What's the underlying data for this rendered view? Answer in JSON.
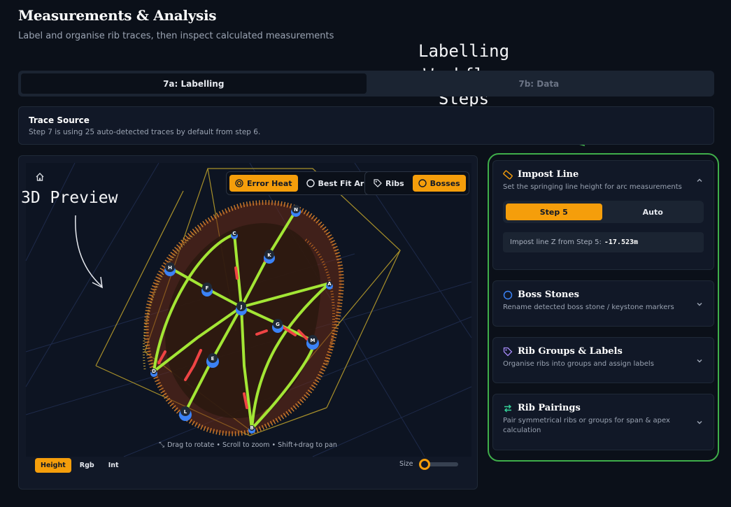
{
  "header": {
    "title": "Measurements & Analysis",
    "subtitle": "Label and organise rib traces, then inspect calculated measurements"
  },
  "annotations": {
    "workflow": "Labelling Workflow Steps",
    "preview": "3D Preview"
  },
  "tabs": [
    {
      "label": "7a: Labelling",
      "active": true
    },
    {
      "label": "7b: Data",
      "active": false
    }
  ],
  "trace_source": {
    "title": "Trace Source",
    "description": "Step 7 is using 25 auto-detected traces by default from step 6."
  },
  "preview": {
    "overlay_toggles": [
      {
        "label": "Error Heat",
        "on": true,
        "icon": "target-icon"
      },
      {
        "label": "Best Fit Arc",
        "on": false,
        "icon": "circle-icon"
      }
    ],
    "marker_toggles": [
      {
        "label": "Ribs",
        "on": false,
        "icon": "tag-icon"
      },
      {
        "label": "Bosses",
        "on": true,
        "icon": "circle-icon"
      }
    ],
    "hint": "Drag to rotate • Scroll to zoom • Shift+drag to pan",
    "color_modes": [
      {
        "label": "Height",
        "on": true
      },
      {
        "label": "Rgb",
        "on": false
      },
      {
        "label": "Int",
        "on": false
      }
    ],
    "size_label": "Size",
    "size_value": 0.15,
    "boss_labels": [
      "N",
      "C",
      "K",
      "H",
      "F",
      "A",
      "J",
      "G",
      "M",
      "E",
      "D",
      "L",
      "B"
    ],
    "colors": {
      "accent": "#f59e0b",
      "rib": "#a3e635",
      "boss": "#3b82f6",
      "error": "#ef4444"
    }
  },
  "steps": {
    "impost": {
      "title": "Impost Line",
      "description": "Set the springing line height for arc measurements",
      "options": [
        {
          "label": "Step 5",
          "on": true
        },
        {
          "label": "Auto",
          "on": false
        }
      ],
      "readout_label": "Impost line Z from Step 5:",
      "readout_value": "-17.523m"
    },
    "boss": {
      "title": "Boss Stones",
      "description": "Rename detected boss stone / keystone markers"
    },
    "groups": {
      "title": "Rib Groups & Labels",
      "description": "Organise ribs into groups and assign labels"
    },
    "pairings": {
      "title": "Rib Pairings",
      "description": "Pair symmetrical ribs or groups for span & apex calculation"
    }
  }
}
